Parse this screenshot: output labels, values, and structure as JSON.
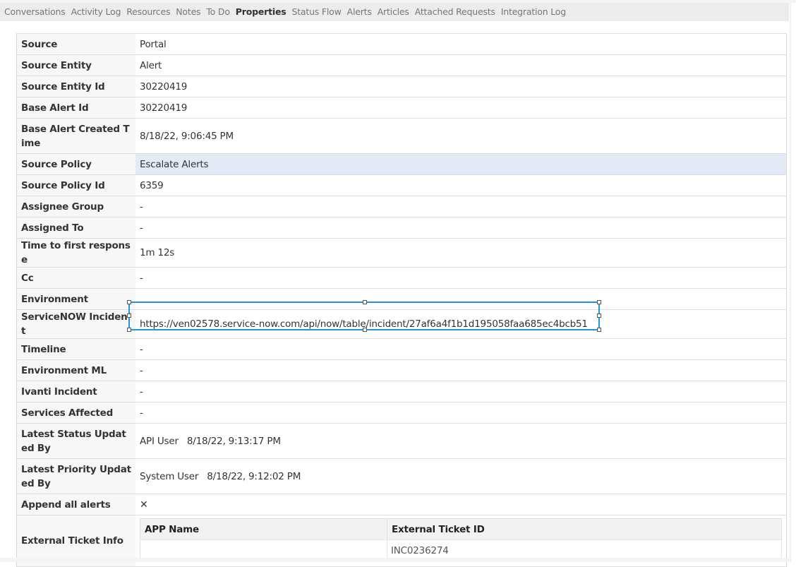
{
  "tabs": [
    {
      "label": "Conversations",
      "active": false
    },
    {
      "label": "Activity Log",
      "active": false
    },
    {
      "label": "Resources",
      "active": false
    },
    {
      "label": "Notes",
      "active": false
    },
    {
      "label": "To Do",
      "active": false
    },
    {
      "label": "Properties",
      "active": true
    },
    {
      "label": "Status Flow",
      "active": false
    },
    {
      "label": "Alerts",
      "active": false
    },
    {
      "label": "Articles",
      "active": false
    },
    {
      "label": "Attached Requests",
      "active": false
    },
    {
      "label": "Integration Log",
      "active": false
    }
  ],
  "properties": {
    "source": {
      "label": "Source",
      "value": "Portal"
    },
    "source_entity": {
      "label": "Source Entity",
      "value": "Alert"
    },
    "source_entity_id": {
      "label": "Source Entity Id",
      "value": "30220419"
    },
    "base_alert_id": {
      "label": "Base Alert Id",
      "value": "30220419"
    },
    "base_alert_created_time": {
      "label": "Base Alert Created Time",
      "value": "8/18/22, 9:06:45 PM"
    },
    "source_policy": {
      "label": "Source Policy",
      "value": "Escalate Alerts"
    },
    "source_policy_id": {
      "label": "Source Policy Id",
      "value": "6359"
    },
    "assignee_group": {
      "label": "Assignee Group",
      "value": "-"
    },
    "assigned_to": {
      "label": "Assigned To",
      "value": "-"
    },
    "time_to_first_response": {
      "label": "Time to first response",
      "value": "1m 12s"
    },
    "cc": {
      "label": "Cc",
      "value": "-"
    },
    "environment": {
      "label": "Environment",
      "value": ""
    },
    "servicenow_incident": {
      "label": "ServiceNOW Incident",
      "value": "https://ven02578.service-now.com/api/now/table/incident/27af6a4f1b1d195058faa685ec4bcb51"
    },
    "timeline": {
      "label": "Timeline",
      "value": "-"
    },
    "environment_ml": {
      "label": "Environment ML",
      "value": "-"
    },
    "ivanti_incident": {
      "label": "Ivanti Incident",
      "value": "-"
    },
    "services_affected": {
      "label": "Services Affected",
      "value": "-"
    },
    "latest_status_updated_by": {
      "label": "Latest Status Updated By",
      "user": "API User",
      "time": "8/18/22, 9:13:17 PM"
    },
    "latest_priority_updated_by": {
      "label": "Latest Priority Updated By",
      "user": "System User",
      "time": "8/18/22, 9:12:02 PM"
    },
    "append_all_alerts": {
      "label": "Append all alerts",
      "value": "✕",
      "icon": "x-icon"
    },
    "external_ticket_info": {
      "label": "External Ticket Info",
      "columns": [
        "APP Name",
        "External Ticket ID"
      ],
      "rows": [
        [
          "",
          "INC0236274"
        ]
      ]
    }
  },
  "colors": {
    "selection_border": "#1e96dc",
    "highlight_row": "#e4eaf5",
    "label_bg": "#f7f7f7",
    "tabbar_bg": "#ececec"
  }
}
